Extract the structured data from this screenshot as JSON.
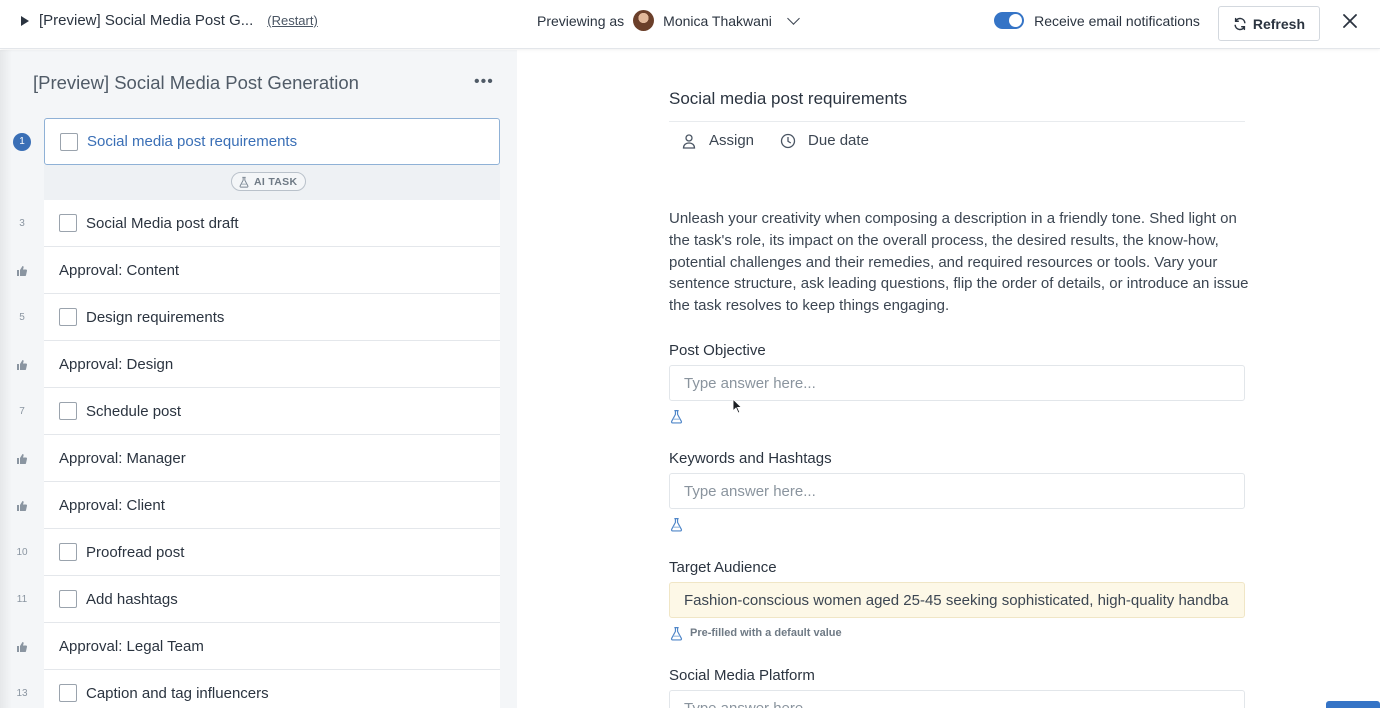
{
  "topbar": {
    "title": "[Preview] Social Media Post G...",
    "restart_label": "(Restart)",
    "previewing_label": "Previewing as",
    "user_name": "Monica Thakwani",
    "notifications_label": "Receive email notifications",
    "notifications_on": true,
    "refresh_label": "Refresh"
  },
  "workflow": {
    "title": "[Preview] Social Media Post Generation",
    "ai_badge": "AI TASK",
    "tasks": [
      {
        "num": "1",
        "label": "Social media post requirements",
        "kind": "task",
        "selected": true
      },
      {
        "num": "3",
        "label": "Social Media post draft",
        "kind": "task"
      },
      {
        "num": "",
        "label": "Approval: Content",
        "kind": "approval"
      },
      {
        "num": "5",
        "label": "Design requirements",
        "kind": "task"
      },
      {
        "num": "",
        "label": "Approval: Design",
        "kind": "approval"
      },
      {
        "num": "7",
        "label": "Schedule post",
        "kind": "task"
      },
      {
        "num": "",
        "label": "Approval: Manager",
        "kind": "approval"
      },
      {
        "num": "",
        "label": "Approval: Client",
        "kind": "approval"
      },
      {
        "num": "10",
        "label": "Proofread post",
        "kind": "task"
      },
      {
        "num": "11",
        "label": "Add hashtags",
        "kind": "task"
      },
      {
        "num": "",
        "label": "Approval: Legal Team",
        "kind": "approval"
      },
      {
        "num": "13",
        "label": "Caption and tag influencers",
        "kind": "task"
      }
    ]
  },
  "detail": {
    "title": "Social media post requirements",
    "assign_label": "Assign",
    "due_label": "Due date",
    "description": "Unleash your creativity when composing a description in a friendly tone. Shed light on the task's role, its impact on the overall process, the desired results, the know-how, potential challenges and their remedies, and required resources or tools. Vary your sentence structure, ask leading questions, flip the order of details, or introduce an issue the task resolves to keep things engaging.",
    "fields": [
      {
        "label": "Post Objective",
        "placeholder": "Type answer here...",
        "value": "",
        "note": ""
      },
      {
        "label": "Keywords and Hashtags",
        "placeholder": "Type answer here...",
        "value": "",
        "note": ""
      },
      {
        "label": "Target Audience",
        "placeholder": "Type answer here...",
        "value": "Fashion-conscious women aged 25-45 seeking sophisticated, high-quality handba",
        "note": "Pre-filled with a default value"
      },
      {
        "label": "Social Media Platform",
        "placeholder": "Type answer here...",
        "value": "",
        "note": ""
      }
    ]
  },
  "colors": {
    "accent": "#3574c6",
    "selected_text": "#3a6fb6",
    "prefilled_bg": "#fdf8e7"
  },
  "icons": {
    "play": "play-icon",
    "chevron": "chevron-down-icon",
    "refresh": "refresh-icon",
    "close": "close-icon",
    "approval": "thumbs-up-icon",
    "ai": "ai-flask-icon",
    "assign": "user-icon",
    "due": "clock-icon"
  }
}
